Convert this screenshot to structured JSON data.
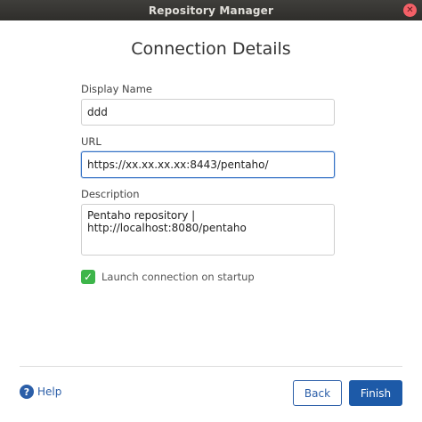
{
  "window": {
    "title": "Repository Manager"
  },
  "dialog": {
    "title": "Connection Details"
  },
  "form": {
    "display_name": {
      "label": "Display Name",
      "value": "ddd"
    },
    "url": {
      "label": "URL",
      "value": "https://xx.xx.xx.xx:8443/pentaho/"
    },
    "description": {
      "label": "Description",
      "value": "Pentaho repository | http://localhost:8080/pentaho"
    },
    "launch_on_startup": {
      "label": "Launch connection on startup",
      "checked": true
    }
  },
  "footer": {
    "help_label": "Help",
    "back_label": "Back",
    "finish_label": "Finish"
  },
  "colors": {
    "accent": "#1d5aa8",
    "checkbox": "#3db54a",
    "titlebar": "#3f3e3b"
  },
  "icons": {
    "close": "close-icon",
    "checkmark": "checkmark-icon",
    "help": "help-icon"
  }
}
